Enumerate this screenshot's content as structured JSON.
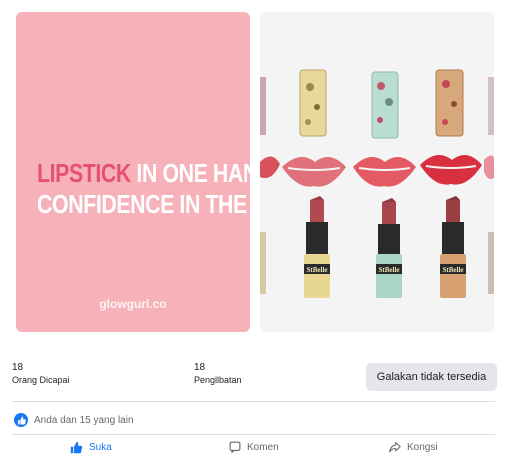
{
  "post": {
    "left_tile": {
      "highlight_word": "LIPSTICK",
      "line1_rest": " IN ONE HAND",
      "line2": "CONFIDENCE IN THE OTHER",
      "watermark": "glowgurl.co",
      "background": "#f6b2b8",
      "accent": "#e5516f"
    },
    "right_tile": {
      "product_brand": "StBelle"
    }
  },
  "stats": {
    "reach_value": "18",
    "reach_label": "Orang Dicapai",
    "engagement_value": "18",
    "engagement_label": "Pengllbatan",
    "promote_label": "Galakan tidak tersedia"
  },
  "reactions": {
    "summary": "Anda dan 15 yang lain"
  },
  "actions": {
    "like_label": "Suka",
    "comment_label": "Komen",
    "share_label": "Kongsi"
  },
  "colors": {
    "facebook_blue": "#1877f2",
    "button_gray": "#e4e6eb",
    "muted_text": "#65676b"
  }
}
